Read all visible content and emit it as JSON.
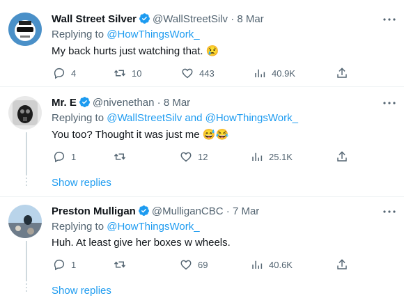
{
  "tweets": [
    {
      "name": "Wall Street Silver",
      "handle": "@WallStreetSilv",
      "date": "· 8 Mar",
      "replying_prefix": "Replying to",
      "replying_to": "@HowThingsWork_",
      "text": "My back hurts just watching that. 😢",
      "stats": {
        "replies": "4",
        "retweets": "10",
        "likes": "443",
        "views": "40.9K"
      }
    },
    {
      "name": "Mr. E",
      "handle": "@nivenethan",
      "date": "· 8 Mar",
      "replying_prefix": "Replying to",
      "replying_to": "@WallStreetSilv and @HowThingsWork_",
      "text": "You too? Thought it was just me 😅😂",
      "stats": {
        "replies": "1",
        "retweets": "",
        "likes": "12",
        "views": "25.1K"
      },
      "show_replies": "Show replies"
    },
    {
      "name": "Preston Mulligan",
      "handle": "@MulliganCBC",
      "date": "· 7 Mar",
      "replying_prefix": "Replying to",
      "replying_to": "@HowThingsWork_",
      "text": "Huh. At least give her boxes w wheels.",
      "stats": {
        "replies": "1",
        "retweets": "",
        "likes": "69",
        "views": "40.6K"
      },
      "show_replies": "Show replies"
    }
  ],
  "colors": {
    "accent": "#1d9bf0",
    "muted": "#536471",
    "text": "#0f1419"
  },
  "icons": [
    "more-icon",
    "verified-badge-icon",
    "reply-icon",
    "retweet-icon",
    "like-icon",
    "views-icon",
    "share-icon"
  ]
}
